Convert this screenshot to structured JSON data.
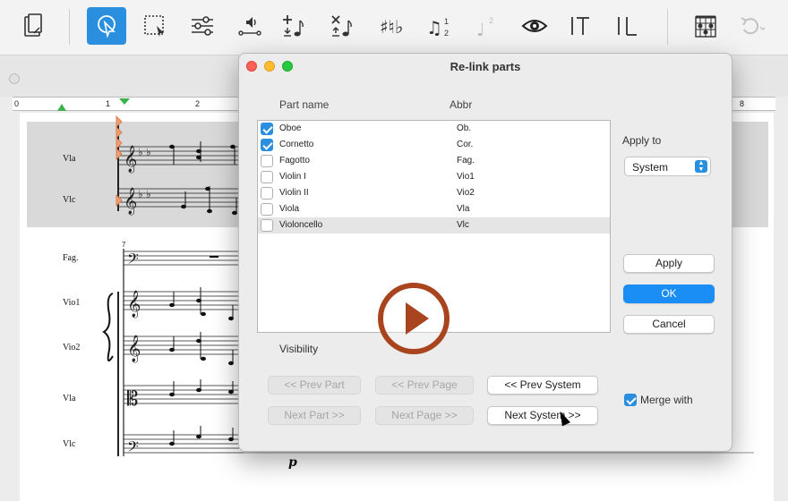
{
  "dialog": {
    "title": "Re-link parts",
    "col_part_name": "Part name",
    "col_abbr": "Abbr",
    "parts": [
      {
        "name": "Oboe",
        "abbr": "Ob.",
        "checked": true,
        "selected": false
      },
      {
        "name": "Cornetto",
        "abbr": "Cor.",
        "checked": true,
        "selected": false
      },
      {
        "name": "Fagotto",
        "abbr": "Fag.",
        "checked": false,
        "selected": false
      },
      {
        "name": "Violin I",
        "abbr": "Vio1",
        "checked": false,
        "selected": false
      },
      {
        "name": "Violin II",
        "abbr": "Vio2",
        "checked": false,
        "selected": false
      },
      {
        "name": "Viola",
        "abbr": "Vla",
        "checked": false,
        "selected": false
      },
      {
        "name": "Violoncello",
        "abbr": "Vlc",
        "checked": false,
        "selected": true
      }
    ],
    "apply_to_label": "Apply to",
    "apply_to_value": "System",
    "apply_button": "Apply",
    "ok_button": "OK",
    "cancel_button": "Cancel",
    "visibility_label": "Visibility",
    "prev_part": "<< Prev Part",
    "prev_page": "<< Prev Page",
    "prev_system": "<< Prev System",
    "next_part": "Next Part >>",
    "next_page": "Next Page >>",
    "next_system": "Next System >>",
    "merge_label": "Merge with",
    "merge_checked": true
  },
  "ruler": {
    "marks": [
      "0",
      "1",
      "2",
      "8"
    ]
  },
  "score": {
    "top_system_instruments": [
      "Vla",
      "Vlc"
    ],
    "bottom_system_instruments": [
      "Fag.",
      "Vio1",
      "Vio2",
      "Vla",
      "Vlc"
    ],
    "measure_number": "7",
    "dynamic": "p"
  },
  "toolbar": {
    "icons": [
      "document-icon",
      "select-icon",
      "marquee-select-icon",
      "mixer-icon",
      "audio-icon",
      "add-note-icon",
      "remove-note-icon",
      "accidentals-icon",
      "voices-icon",
      "voice-2-icon",
      "eye-icon",
      "text-icon",
      "lyrics-icon",
      "chord-diagram-icon",
      "undo-icon"
    ]
  },
  "colors": {
    "accent": "#1a8ef5",
    "play": "#a8451e"
  }
}
